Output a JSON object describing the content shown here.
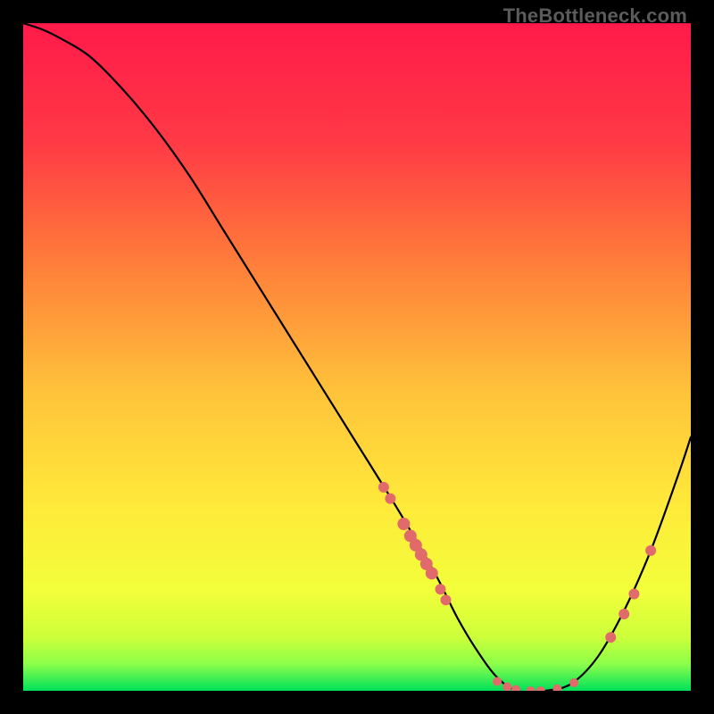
{
  "watermark": "TheBottleneck.com",
  "chart_data": {
    "type": "line",
    "title": "",
    "xlabel": "",
    "ylabel": "",
    "xlim": [
      0,
      100
    ],
    "ylim": [
      0,
      100
    ],
    "gradient_colors": {
      "top": "#ff1a4a",
      "upper_mid": "#ff6a3a",
      "mid": "#ffd93a",
      "lower_mid": "#f7ff3a",
      "bottom_band": "#d6ff3a",
      "green": "#00e05a"
    },
    "series": [
      {
        "name": "bottleneck-curve",
        "x": [
          0,
          3,
          6,
          10,
          15,
          20,
          25,
          30,
          35,
          40,
          45,
          50,
          55,
          58,
          62,
          65,
          68,
          71,
          74,
          78,
          82,
          86,
          90,
          94,
          98,
          100
        ],
        "y": [
          100,
          99,
          97.5,
          95,
          90,
          84,
          77,
          69,
          61,
          53,
          45,
          37,
          29,
          24,
          17,
          11,
          6,
          2,
          0,
          0,
          1,
          5,
          12,
          21,
          32,
          38
        ]
      }
    ],
    "markers": {
      "name": "highlight-points",
      "color": "#e16b6b",
      "radius_small": 5,
      "radius_large": 7,
      "points": [
        {
          "x": 54.0,
          "y": 30.5,
          "r": 6
        },
        {
          "x": 55.0,
          "y": 28.8,
          "r": 6
        },
        {
          "x": 57.0,
          "y": 25.0,
          "r": 7
        },
        {
          "x": 58.0,
          "y": 23.2,
          "r": 7
        },
        {
          "x": 58.8,
          "y": 21.8,
          "r": 7
        },
        {
          "x": 59.6,
          "y": 20.4,
          "r": 7
        },
        {
          "x": 60.4,
          "y": 19.0,
          "r": 7
        },
        {
          "x": 61.2,
          "y": 17.6,
          "r": 7
        },
        {
          "x": 62.5,
          "y": 15.2,
          "r": 6
        },
        {
          "x": 63.3,
          "y": 13.6,
          "r": 6
        },
        {
          "x": 71.0,
          "y": 1.4,
          "r": 5
        },
        {
          "x": 72.5,
          "y": 0.6,
          "r": 5
        },
        {
          "x": 73.8,
          "y": 0.2,
          "r": 5
        },
        {
          "x": 76.0,
          "y": 0.0,
          "r": 5
        },
        {
          "x": 77.5,
          "y": 0.0,
          "r": 5
        },
        {
          "x": 80.0,
          "y": 0.3,
          "r": 5
        },
        {
          "x": 82.5,
          "y": 1.2,
          "r": 5
        },
        {
          "x": 88.0,
          "y": 8.0,
          "r": 6
        },
        {
          "x": 90.0,
          "y": 11.5,
          "r": 6
        },
        {
          "x": 91.5,
          "y": 14.5,
          "r": 6
        },
        {
          "x": 94.0,
          "y": 21.0,
          "r": 6
        }
      ]
    }
  }
}
